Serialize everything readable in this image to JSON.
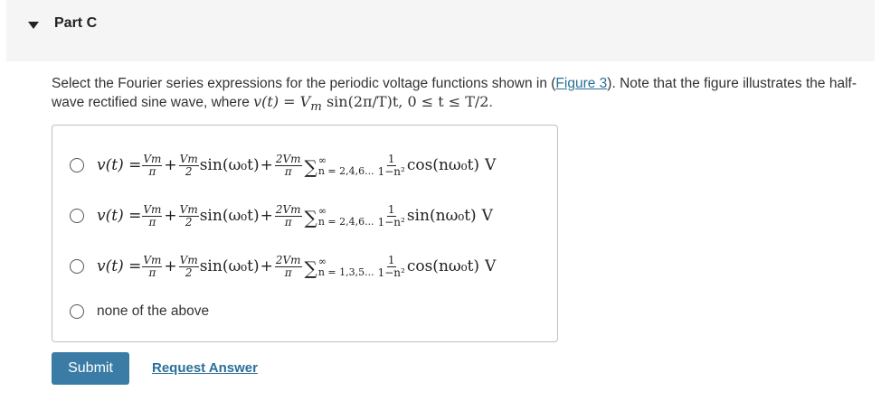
{
  "header": {
    "title": "Part C",
    "toggle_icon": "triangle-down-icon"
  },
  "question": {
    "text_before": "Select the Fourier series expressions for the periodic voltage functions shown in (",
    "link_text": "Figure 3",
    "text_after": "). Note that the figure illustrates the half-wave rectified sine wave, where ",
    "math_v": "v(t)",
    "math_eq": " = ",
    "math_vm": "V",
    "math_m": "m",
    "math_sin": " sin(2π/T)t, 0 ≤ t ≤ T/2",
    "end": "."
  },
  "choices": [
    {
      "lhs": "v(t) =",
      "t1_num": "Vm",
      "t1_den": "π",
      "t2_num": "Vm",
      "t2_den": "2",
      "t2_fn": "sin(ω₀t)",
      "t3_num": "2Vm",
      "t3_den": "π",
      "sum_upper": "∞",
      "sum_lower": "n = 2,4,6...",
      "t4_num": "1",
      "t4_den": "1−n²",
      "t4_fn": "cos(nω₀t)",
      "unit": "V"
    },
    {
      "lhs": "v(t) =",
      "t1_num": "Vm",
      "t1_den": "π",
      "t2_num": "Vm",
      "t2_den": "2",
      "t2_fn": "sin(ω₀t)",
      "t3_num": "2Vm",
      "t3_den": "π",
      "sum_upper": "∞",
      "sum_lower": "n = 2,4,6...",
      "t4_num": "1",
      "t4_den": "1−n²",
      "t4_fn": "sin(nω₀t)",
      "unit": "V"
    },
    {
      "lhs": "v(t) =",
      "t1_num": "Vm",
      "t1_den": "π",
      "t2_num": "Vm",
      "t2_den": "2",
      "t2_fn": "sin(ω₀t)",
      "t3_num": "2Vm",
      "t3_den": "π",
      "sum_upper": "∞",
      "sum_lower": "n = 1,3,5...",
      "t4_num": "1",
      "t4_den": "1−n²",
      "t4_fn": "cos(nω₀t)",
      "unit": "V"
    }
  ],
  "none_option": "none of the above",
  "actions": {
    "submit_label": "Submit",
    "request_label": "Request Answer"
  }
}
